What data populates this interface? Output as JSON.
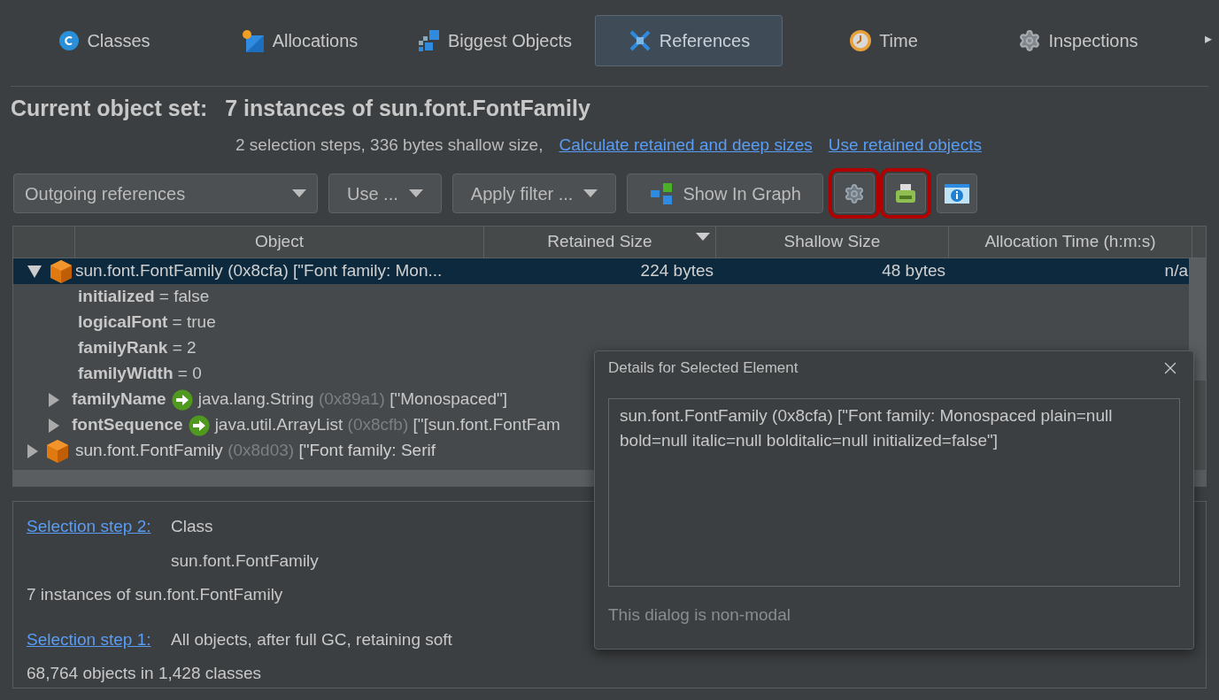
{
  "tabs": [
    {
      "kind": "classes",
      "label": "Classes",
      "selected": false
    },
    {
      "kind": "allocations",
      "label": "Allocations",
      "selected": false
    },
    {
      "kind": "biggest",
      "label": "Biggest Objects",
      "selected": false
    },
    {
      "kind": "references",
      "label": "References",
      "selected": true
    },
    {
      "kind": "time",
      "label": "Time",
      "selected": false
    },
    {
      "kind": "inspections",
      "label": "Inspections",
      "selected": false
    }
  ],
  "tab_scroll": "▸",
  "object_set": {
    "label": "Current object set:",
    "value": "7 instances of sun.font.FontFamily",
    "summary": "2 selection steps, 336 bytes shallow size,",
    "links": [
      "Calculate retained and deep sizes",
      "Use retained objects"
    ]
  },
  "toolbar": [
    {
      "kind": "dropdown",
      "label": "Outgoing references"
    },
    {
      "kind": "menu",
      "label": "Use ..."
    },
    {
      "kind": "menu",
      "label": "Apply filter ..."
    },
    {
      "kind": "graph",
      "label": "Show In Graph"
    },
    {
      "kind": "gear",
      "highlighted": true
    },
    {
      "kind": "printer",
      "highlighted": true
    },
    {
      "kind": "info",
      "highlighted": false
    }
  ],
  "table": {
    "columns": [
      {
        "label": "Object",
        "sorted": false
      },
      {
        "label": "Retained Size",
        "sorted": true
      },
      {
        "label": "Shallow Size",
        "sorted": false
      },
      {
        "label": "Allocation Time (h:m:s)",
        "sorted": false
      }
    ],
    "rows": [
      {
        "kind": "object",
        "class": "sun.font.FontFamily",
        "id": "(0x8cfa)",
        "detail": "[\"Font family: Mon...",
        "selected": true,
        "expanded": true,
        "retained": "224 bytes",
        "shallow": "48 bytes",
        "time": "n/a",
        "children": [
          {
            "kind": "field",
            "name": "initialized",
            "value": "= false"
          },
          {
            "kind": "field",
            "name": "logicalFont",
            "value": "= true"
          },
          {
            "kind": "field",
            "name": "familyRank",
            "value": "= 2"
          },
          {
            "kind": "field",
            "name": "familyWidth",
            "value": "= 0"
          },
          {
            "kind": "reference",
            "name": "familyName",
            "expanded": false,
            "class": "java.lang.String",
            "id": "(0x89a1)",
            "detail": "[\"Monospaced\"]"
          },
          {
            "kind": "reference",
            "name": "fontSequence",
            "expanded": false,
            "class": "java.util.ArrayList",
            "id": "(0x8cfb)",
            "detail": "[\"[sun.font.FontFam"
          }
        ]
      },
      {
        "kind": "object",
        "class": "sun.font.FontFamily",
        "id": "(0x8d03)",
        "detail": "[\"Font family: Serif",
        "selected": false,
        "expanded": false
      }
    ]
  },
  "selection_steps": [
    {
      "link": "Selection step 2:",
      "lines": [
        "Class",
        "sun.font.FontFamily"
      ],
      "summary": "7 instances of sun.font.FontFamily"
    },
    {
      "link": "Selection step 1:",
      "lines": [
        "All objects, after full GC, retaining soft"
      ],
      "summary": "68,764 objects in 1,428 classes"
    }
  ],
  "dialog": {
    "title": "Details for Selected Element",
    "text": "sun.font.FontFamily (0x8cfa) [\"Font family: Monospaced plain=null bold=null italic=null bolditalic=null initialized=false\"]",
    "note": "This dialog is non-modal"
  }
}
